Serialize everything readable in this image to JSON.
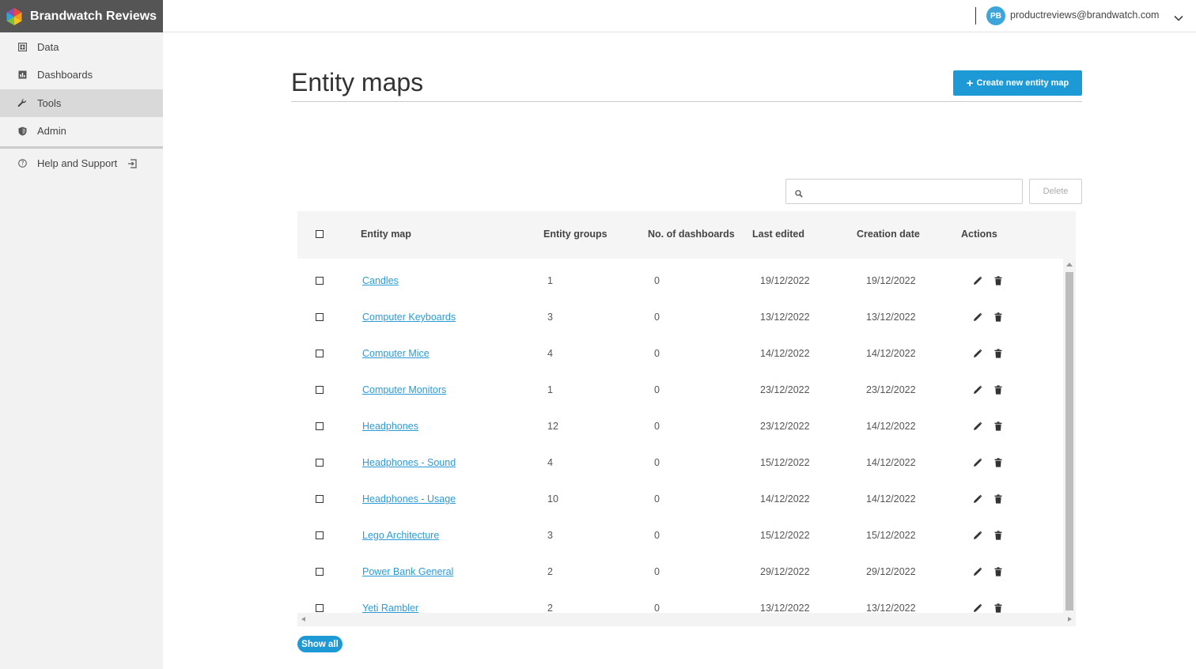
{
  "brand": {
    "name": "Brandwatch Reviews"
  },
  "sidebar": {
    "items": [
      {
        "label": "Data",
        "icon": "database-plus-icon"
      },
      {
        "label": "Dashboards",
        "icon": "bar-chart-icon"
      },
      {
        "label": "Tools",
        "icon": "wrench-icon",
        "active": true
      },
      {
        "label": "Admin",
        "icon": "shield-icon"
      }
    ],
    "help": {
      "label": "Help and Support",
      "icon": "question-circle-icon"
    }
  },
  "header": {
    "avatar_initials": "PB",
    "user_email": "productreviews@brandwatch.com"
  },
  "main": {
    "title": "Entity maps",
    "create_button": "Create new entity map",
    "search_placeholder": "",
    "delete_button": "Delete",
    "show_all_button": "Show all"
  },
  "table": {
    "columns": [
      "Entity map",
      "Entity groups",
      "No. of dashboards",
      "Last edited",
      "Creation date",
      "Actions"
    ],
    "rows": [
      {
        "name": "Candles",
        "groups": "1",
        "dashboards": "0",
        "last_edited": "19/12/2022",
        "created": "19/12/2022"
      },
      {
        "name": "Computer Keyboards",
        "groups": "3",
        "dashboards": "0",
        "last_edited": "13/12/2022",
        "created": "13/12/2022"
      },
      {
        "name": "Computer Mice",
        "groups": "4",
        "dashboards": "0",
        "last_edited": "14/12/2022",
        "created": "14/12/2022"
      },
      {
        "name": "Computer Monitors",
        "groups": "1",
        "dashboards": "0",
        "last_edited": "23/12/2022",
        "created": "23/12/2022"
      },
      {
        "name": "Headphones",
        "groups": "12",
        "dashboards": "0",
        "last_edited": "23/12/2022",
        "created": "14/12/2022"
      },
      {
        "name": "Headphones - Sound",
        "groups": "4",
        "dashboards": "0",
        "last_edited": "15/12/2022",
        "created": "14/12/2022"
      },
      {
        "name": "Headphones - Usage",
        "groups": "10",
        "dashboards": "0",
        "last_edited": "14/12/2022",
        "created": "14/12/2022"
      },
      {
        "name": "Lego Architecture",
        "groups": "3",
        "dashboards": "0",
        "last_edited": "15/12/2022",
        "created": "15/12/2022"
      },
      {
        "name": "Power Bank General",
        "groups": "2",
        "dashboards": "0",
        "last_edited": "29/12/2022",
        "created": "29/12/2022"
      },
      {
        "name": "Yeti Rambler",
        "groups": "2",
        "dashboards": "0",
        "last_edited": "13/12/2022",
        "created": "13/12/2022"
      }
    ]
  },
  "colors": {
    "brand_bar": "#555555",
    "accent": "#1d9ad6",
    "link": "#2a9bd6",
    "avatar": "#3da5d9"
  }
}
